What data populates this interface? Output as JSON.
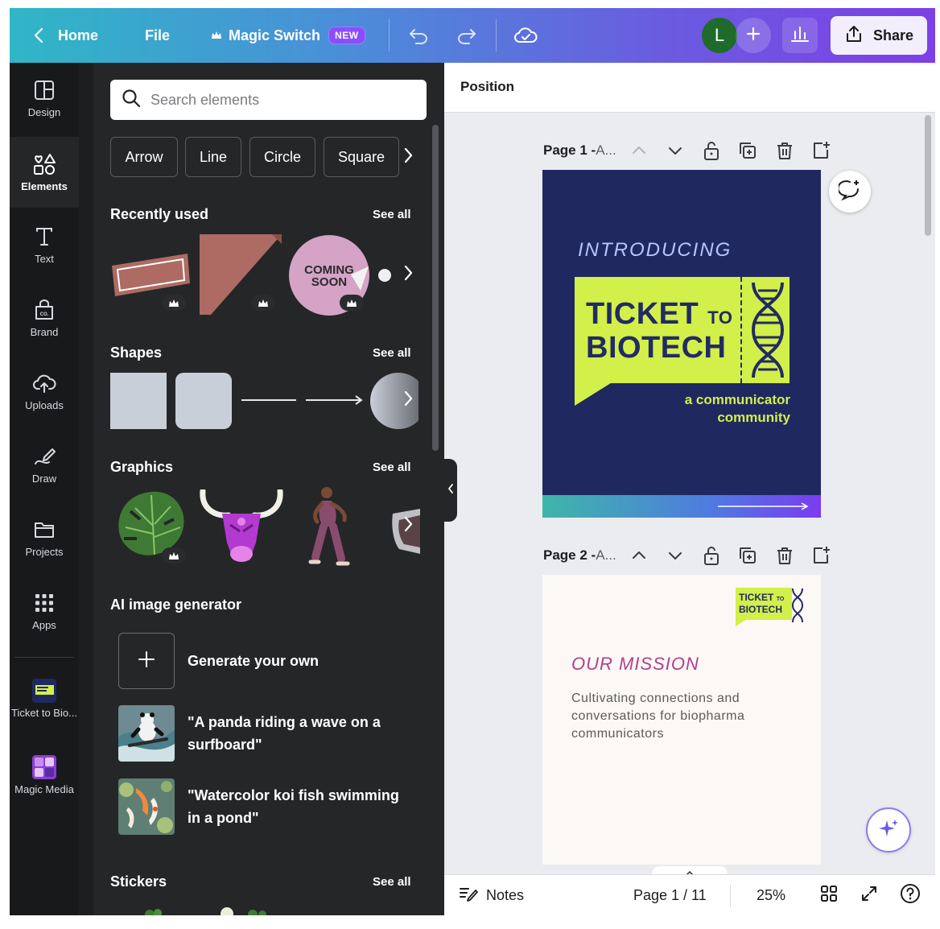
{
  "topbar": {
    "home_label": "Home",
    "file_label": "File",
    "magic_switch_label": "Magic Switch",
    "new_badge": "NEW",
    "avatar_initial": "L",
    "share_label": "Share",
    "gradient_colors": [
      "#2fb7c6",
      "#6a5ce0",
      "#7d3fe6"
    ]
  },
  "rail": {
    "items": [
      {
        "label": "Design",
        "icon": "layout-icon"
      },
      {
        "label": "Elements",
        "icon": "shapes-icon"
      },
      {
        "label": "Text",
        "icon": "text-icon"
      },
      {
        "label": "Brand",
        "icon": "brand-icon"
      },
      {
        "label": "Uploads",
        "icon": "cloud-upload-icon"
      },
      {
        "label": "Draw",
        "icon": "pen-icon"
      },
      {
        "label": "Projects",
        "icon": "folder-icon"
      },
      {
        "label": "Apps",
        "icon": "grid-icon"
      },
      {
        "label": "Ticket to Bio...",
        "icon": "app-thumb"
      },
      {
        "label": "Magic Media",
        "icon": "app-thumb"
      }
    ],
    "active": "Elements"
  },
  "panel": {
    "search_placeholder": "Search elements",
    "chips": [
      "Arrow",
      "Line",
      "Circle",
      "Square"
    ],
    "recently_used": {
      "title": "Recently used",
      "see_all": "See all",
      "coming_soon": [
        "COMING",
        "SOON"
      ]
    },
    "shapes": {
      "title": "Shapes",
      "see_all": "See all"
    },
    "graphics": {
      "title": "Graphics",
      "see_all": "See all"
    },
    "ai_generator": {
      "title": "AI image generator",
      "items": [
        "Generate your own",
        "\"A panda riding a wave on a surfboard\"",
        "\"Watercolor koi fish swimming in a pond\""
      ]
    },
    "stickers": {
      "title": "Stickers",
      "see_all": "See all"
    }
  },
  "canvas": {
    "position_label": "Position",
    "pages": [
      {
        "label": "Page 1 - ",
        "name": "A..."
      },
      {
        "label": "Page 2 - ",
        "name": "A..."
      }
    ],
    "page1": {
      "introducing": "INTRODUCING",
      "title_line1": "TICKET",
      "title_to": "TO",
      "title_line2": "BIOTECH",
      "tagline_line1": "a communicator",
      "tagline_line2": "community"
    },
    "page2": {
      "logo_line1": "TICKET",
      "logo_to": "TO",
      "logo_line2": "BIOTECH",
      "title": "OUR MISSION",
      "body": "Cultivating connections and conversations for biopharma communicators"
    }
  },
  "footer": {
    "notes_label": "Notes",
    "page_indicator": "Page 1 / 11",
    "zoom": "25%"
  }
}
